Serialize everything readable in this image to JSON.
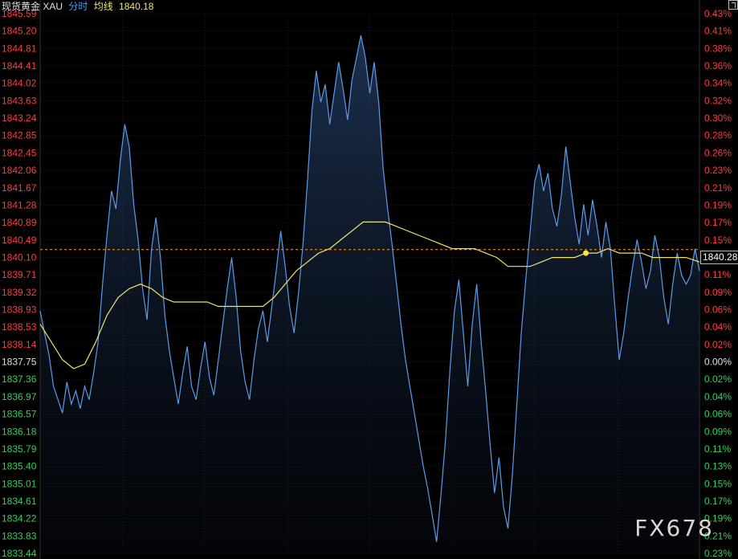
{
  "header": {
    "instrument": "现货黄金 XAU",
    "mode": "分时",
    "avg_label": "均线",
    "avg_value": "1840.18"
  },
  "price_tag": "1840.28",
  "watermark": "FX678",
  "colors": {
    "up": "#ff3b3b",
    "down": "#2fd25a",
    "neutral": "#e0e0e0",
    "price_line": "#5b9bea",
    "avg_line": "#f2e36a",
    "ref_line": "#ff9a1f"
  },
  "chart_data": {
    "type": "line",
    "ylim": [
      1833.44,
      1845.59
    ],
    "reference_price": 1837.75,
    "y_ticks_left": [
      "1845.59",
      "1845.20",
      "1844.81",
      "1844.41",
      "1844.02",
      "1843.63",
      "1843.24",
      "1842.85",
      "1842.45",
      "1842.06",
      "1841.67",
      "1841.28",
      "1840.89",
      "1840.49",
      "1840.10",
      "1839.71",
      "1839.32",
      "1838.93",
      "1838.53",
      "1838.14",
      "1837.75",
      "1837.36",
      "1836.97",
      "1836.57",
      "1836.18",
      "1835.79",
      "1835.40",
      "1835.01",
      "1834.61",
      "1834.22",
      "1833.83",
      "1833.44"
    ],
    "y_ticks_right": [
      "0.43%",
      "0.41%",
      "0.38%",
      "0.36%",
      "0.34%",
      "0.32%",
      "0.30%",
      "0.28%",
      "0.26%",
      "0.23%",
      "0.21%",
      "0.19%",
      "0.17%",
      "0.15%",
      "0.13%",
      "0.11%",
      "0.09%",
      "0.06%",
      "0.04%",
      "0.02%",
      "0.00%",
      "0.02%",
      "0.04%",
      "0.06%",
      "0.09%",
      "0.11%",
      "0.13%",
      "0.15%",
      "0.17%",
      "0.19%",
      "0.21%",
      "0.23%"
    ],
    "price_series": [
      [
        0,
        1838.9
      ],
      [
        2,
        1838.4
      ],
      [
        4,
        1837.9
      ],
      [
        6,
        1837.2
      ],
      [
        8,
        1836.9
      ],
      [
        10,
        1836.6
      ],
      [
        12,
        1837.3
      ],
      [
        14,
        1836.8
      ],
      [
        16,
        1837.1
      ],
      [
        18,
        1836.7
      ],
      [
        20,
        1837.2
      ],
      [
        22,
        1836.9
      ],
      [
        24,
        1837.5
      ],
      [
        26,
        1838.2
      ],
      [
        28,
        1839.5
      ],
      [
        30,
        1840.6
      ],
      [
        32,
        1841.6
      ],
      [
        34,
        1841.2
      ],
      [
        36,
        1842.3
      ],
      [
        38,
        1843.1
      ],
      [
        40,
        1842.6
      ],
      [
        42,
        1841.3
      ],
      [
        44,
        1840.5
      ],
      [
        46,
        1839.4
      ],
      [
        48,
        1838.7
      ],
      [
        50,
        1840.3
      ],
      [
        52,
        1841.0
      ],
      [
        54,
        1840.1
      ],
      [
        56,
        1838.8
      ],
      [
        58,
        1838.0
      ],
      [
        60,
        1837.4
      ],
      [
        62,
        1836.8
      ],
      [
        64,
        1837.5
      ],
      [
        66,
        1838.1
      ],
      [
        68,
        1837.2
      ],
      [
        70,
        1836.9
      ],
      [
        72,
        1837.6
      ],
      [
        74,
        1838.2
      ],
      [
        76,
        1837.4
      ],
      [
        78,
        1837.0
      ],
      [
        80,
        1837.8
      ],
      [
        82,
        1838.6
      ],
      [
        84,
        1839.4
      ],
      [
        86,
        1840.1
      ],
      [
        88,
        1839.2
      ],
      [
        90,
        1838.0
      ],
      [
        92,
        1837.3
      ],
      [
        94,
        1836.9
      ],
      [
        96,
        1837.8
      ],
      [
        98,
        1838.5
      ],
      [
        100,
        1838.9
      ],
      [
        102,
        1838.2
      ],
      [
        104,
        1839.0
      ],
      [
        106,
        1839.8
      ],
      [
        108,
        1840.7
      ],
      [
        110,
        1839.9
      ],
      [
        112,
        1839.0
      ],
      [
        114,
        1838.4
      ],
      [
        116,
        1839.3
      ],
      [
        118,
        1840.4
      ],
      [
        120,
        1841.8
      ],
      [
        122,
        1843.4
      ],
      [
        124,
        1844.3
      ],
      [
        126,
        1843.6
      ],
      [
        128,
        1844.0
      ],
      [
        130,
        1843.1
      ],
      [
        132,
        1843.8
      ],
      [
        134,
        1844.5
      ],
      [
        136,
        1843.9
      ],
      [
        138,
        1843.2
      ],
      [
        140,
        1844.1
      ],
      [
        142,
        1844.6
      ],
      [
        144,
        1845.1
      ],
      [
        146,
        1844.6
      ],
      [
        148,
        1843.8
      ],
      [
        150,
        1844.5
      ],
      [
        152,
        1843.6
      ],
      [
        154,
        1842.1
      ],
      [
        156,
        1841.2
      ],
      [
        158,
        1840.4
      ],
      [
        160,
        1839.5
      ],
      [
        162,
        1838.6
      ],
      [
        164,
        1837.8
      ],
      [
        166,
        1837.2
      ],
      [
        168,
        1836.6
      ],
      [
        170,
        1836.0
      ],
      [
        172,
        1835.4
      ],
      [
        174,
        1834.9
      ],
      [
        176,
        1834.3
      ],
      [
        178,
        1833.7
      ],
      [
        180,
        1834.8
      ],
      [
        182,
        1836.0
      ],
      [
        184,
        1837.6
      ],
      [
        186,
        1838.9
      ],
      [
        188,
        1839.6
      ],
      [
        190,
        1838.4
      ],
      [
        192,
        1837.2
      ],
      [
        194,
        1838.6
      ],
      [
        196,
        1839.5
      ],
      [
        198,
        1838.2
      ],
      [
        200,
        1837.1
      ],
      [
        202,
        1835.9
      ],
      [
        204,
        1834.8
      ],
      [
        206,
        1835.6
      ],
      [
        208,
        1834.5
      ],
      [
        210,
        1834.0
      ],
      [
        212,
        1835.2
      ],
      [
        214,
        1836.8
      ],
      [
        216,
        1838.4
      ],
      [
        218,
        1839.6
      ],
      [
        220,
        1840.7
      ],
      [
        222,
        1841.8
      ],
      [
        224,
        1842.2
      ],
      [
        226,
        1841.6
      ],
      [
        228,
        1842.0
      ],
      [
        230,
        1841.2
      ],
      [
        232,
        1840.8
      ],
      [
        234,
        1841.5
      ],
      [
        236,
        1842.6
      ],
      [
        238,
        1841.8
      ],
      [
        240,
        1841.0
      ],
      [
        242,
        1840.4
      ],
      [
        244,
        1841.3
      ],
      [
        246,
        1840.6
      ],
      [
        248,
        1841.4
      ],
      [
        250,
        1840.8
      ],
      [
        252,
        1840.1
      ],
      [
        254,
        1840.9
      ],
      [
        256,
        1840.3
      ],
      [
        258,
        1839.0
      ],
      [
        260,
        1837.8
      ],
      [
        262,
        1838.4
      ],
      [
        264,
        1839.2
      ],
      [
        266,
        1839.9
      ],
      [
        268,
        1840.5
      ],
      [
        270,
        1840.0
      ],
      [
        272,
        1839.4
      ],
      [
        274,
        1839.8
      ],
      [
        276,
        1840.6
      ],
      [
        278,
        1840.1
      ],
      [
        280,
        1839.2
      ],
      [
        282,
        1838.6
      ],
      [
        284,
        1839.5
      ],
      [
        286,
        1840.2
      ],
      [
        288,
        1839.7
      ],
      [
        290,
        1839.5
      ],
      [
        292,
        1839.7
      ],
      [
        294,
        1840.3
      ],
      [
        296,
        1839.8
      ]
    ],
    "avg_series": [
      [
        0,
        1838.6
      ],
      [
        5,
        1838.2
      ],
      [
        10,
        1837.8
      ],
      [
        15,
        1837.6
      ],
      [
        20,
        1837.7
      ],
      [
        25,
        1838.2
      ],
      [
        30,
        1838.8
      ],
      [
        35,
        1839.2
      ],
      [
        40,
        1839.4
      ],
      [
        45,
        1839.5
      ],
      [
        50,
        1839.4
      ],
      [
        55,
        1839.2
      ],
      [
        60,
        1839.1
      ],
      [
        65,
        1839.1
      ],
      [
        70,
        1839.1
      ],
      [
        75,
        1839.1
      ],
      [
        80,
        1839.0
      ],
      [
        85,
        1839.0
      ],
      [
        90,
        1839.0
      ],
      [
        95,
        1839.0
      ],
      [
        100,
        1839.0
      ],
      [
        105,
        1839.2
      ],
      [
        110,
        1839.5
      ],
      [
        115,
        1839.8
      ],
      [
        120,
        1840.0
      ],
      [
        125,
        1840.2
      ],
      [
        130,
        1840.3
      ],
      [
        135,
        1840.5
      ],
      [
        140,
        1840.7
      ],
      [
        145,
        1840.9
      ],
      [
        150,
        1840.9
      ],
      [
        155,
        1840.9
      ],
      [
        160,
        1840.8
      ],
      [
        165,
        1840.7
      ],
      [
        170,
        1840.6
      ],
      [
        175,
        1840.5
      ],
      [
        180,
        1840.4
      ],
      [
        185,
        1840.3
      ],
      [
        190,
        1840.3
      ],
      [
        195,
        1840.3
      ],
      [
        200,
        1840.2
      ],
      [
        205,
        1840.1
      ],
      [
        210,
        1839.9
      ],
      [
        215,
        1839.9
      ],
      [
        220,
        1839.9
      ],
      [
        225,
        1840.0
      ],
      [
        230,
        1840.1
      ],
      [
        235,
        1840.1
      ],
      [
        240,
        1840.1
      ],
      [
        245,
        1840.2
      ],
      [
        250,
        1840.2
      ],
      [
        255,
        1840.3
      ],
      [
        260,
        1840.2
      ],
      [
        265,
        1840.2
      ],
      [
        270,
        1840.2
      ],
      [
        275,
        1840.1
      ],
      [
        280,
        1840.1
      ],
      [
        285,
        1840.1
      ],
      [
        290,
        1840.1
      ],
      [
        296,
        1840.0
      ]
    ],
    "x_max": 296,
    "marker_price": 1840.2,
    "marker_x": 245,
    "dashed_reference_price": 1840.28,
    "grid": true
  }
}
